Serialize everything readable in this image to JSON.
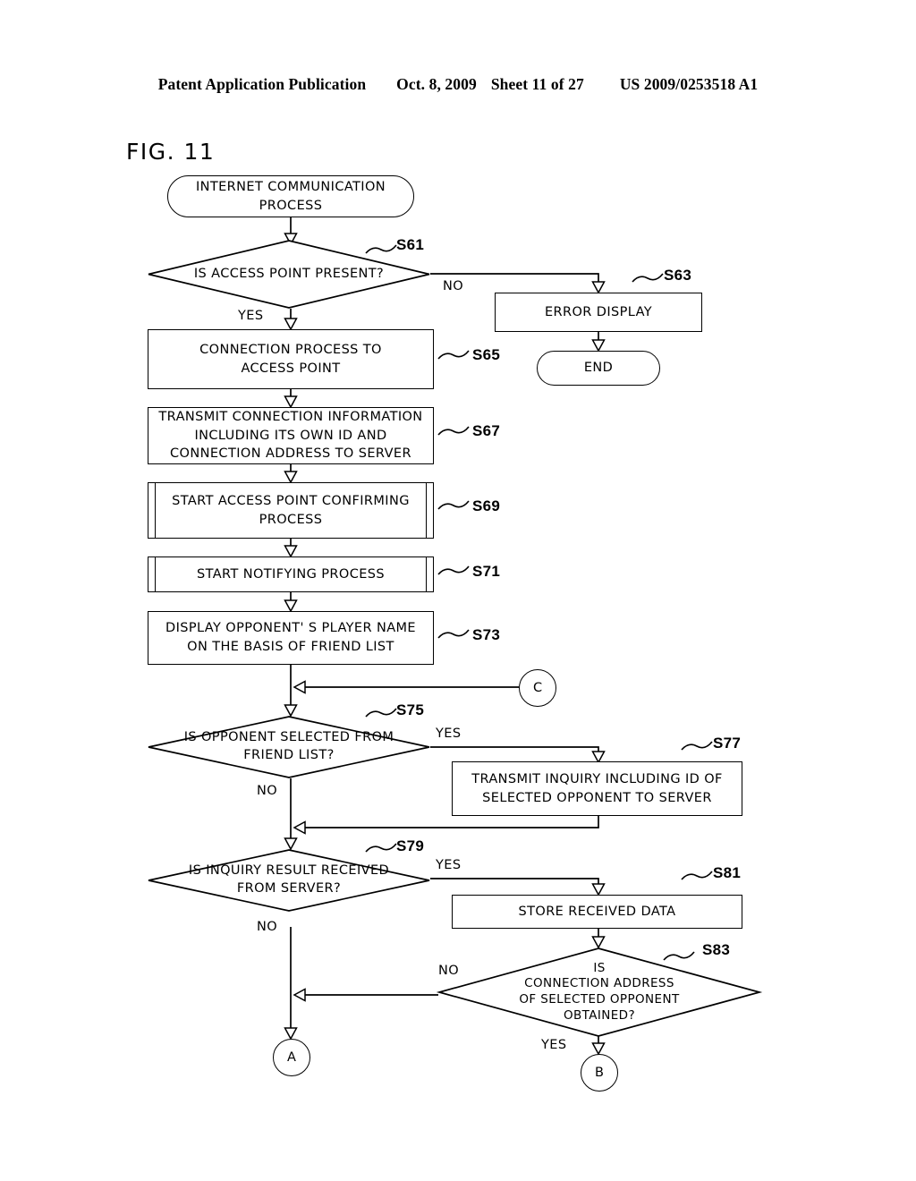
{
  "header": {
    "publication": "Patent Application Publication",
    "date": "Oct. 8, 2009",
    "sheet": "Sheet 11 of 27",
    "docnum": "US 2009/0253518 A1"
  },
  "figure": {
    "label": "FIG. 11"
  },
  "nodes": {
    "start": {
      "text": "INTERNET COMMUNICATION\nPROCESS"
    },
    "s61": {
      "step": "S61",
      "text": "IS ACCESS POINT PRESENT?"
    },
    "s63": {
      "step": "S63",
      "text": "ERROR DISPLAY"
    },
    "end": {
      "text": "END"
    },
    "s65": {
      "step": "S65",
      "text": "CONNECTION PROCESS TO\nACCESS POINT"
    },
    "s67": {
      "step": "S67",
      "text": "TRANSMIT CONNECTION INFORMATION\nINCLUDING ITS OWN ID AND\nCONNECTION ADDRESS TO SERVER"
    },
    "s69": {
      "step": "S69",
      "text": "START ACCESS POINT CONFIRMING\nPROCESS"
    },
    "s71": {
      "step": "S71",
      "text": "START NOTIFYING PROCESS"
    },
    "s73": {
      "step": "S73",
      "text": "DISPLAY OPPONENT' S PLAYER NAME\nON THE BASIS OF FRIEND LIST"
    },
    "s75": {
      "step": "S75",
      "text": "IS OPPONENT SELECTED FROM\nFRIEND LIST?"
    },
    "s77": {
      "step": "S77",
      "text": "TRANSMIT INQUIRY INCLUDING ID OF\nSELECTED OPPONENT TO SERVER"
    },
    "s79": {
      "step": "S79",
      "text": "IS INQUIRY RESULT RECEIVED\nFROM SERVER?"
    },
    "s81": {
      "step": "S81",
      "text": "STORE RECEIVED DATA"
    },
    "s83": {
      "step": "S83",
      "text": "IS\nCONNECTION ADDRESS\nOF SELECTED OPPONENT\nOBTAINED?"
    }
  },
  "connectors": {
    "c": "C",
    "a": "A",
    "b": "B"
  },
  "branches": {
    "s61_yes": "YES",
    "s61_no": "NO",
    "s75_yes": "YES",
    "s75_no": "NO",
    "s79_yes": "YES",
    "s79_no": "NO",
    "s83_yes": "YES",
    "s83_no": "NO"
  },
  "colors": {
    "ink": "#000000",
    "paper": "#ffffff"
  }
}
